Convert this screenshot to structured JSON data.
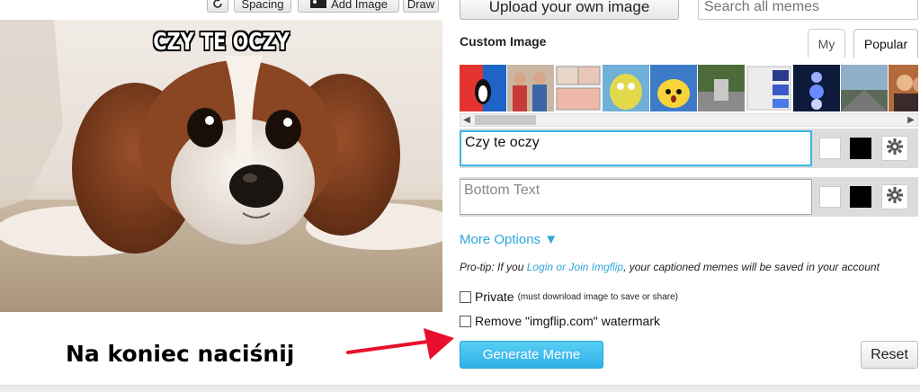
{
  "toolbar": {
    "rotate_icon": "rotate-icon",
    "spacing_label": "Spacing",
    "add_image_icon": "image-icon",
    "add_image_label": "Add Image",
    "draw_label": "Draw"
  },
  "meme": {
    "top_caption": "CZY TE OCZY"
  },
  "upload": {
    "label": "Upload your own image"
  },
  "search": {
    "placeholder": "Search all memes"
  },
  "custom_image": {
    "title": "Custom Image",
    "tabs": [
      "My",
      "Popular"
    ],
    "active_tab": "Popular"
  },
  "text_boxes": [
    {
      "value": "Czy te oczy",
      "placeholder": ""
    },
    {
      "value": "",
      "placeholder": "Bottom Text"
    }
  ],
  "colors": {
    "outline_white": "#ffffff",
    "outline_black": "#000000",
    "accent": "#2fa7dc",
    "generate": "#3bbdee"
  },
  "more_options": {
    "label": "More Options ▼"
  },
  "protip": {
    "prefix": "Pro-tip: If you ",
    "link": "Login or Join Imgflip",
    "suffix": ", your captioned memes will be saved in your account"
  },
  "private": {
    "label": "Private",
    "note": "(must download image to save or share)"
  },
  "watermark": {
    "label": "Remove \"imgflip.com\" watermark"
  },
  "generate": {
    "label": "Generate Meme"
  },
  "reset": {
    "label": "Reset"
  },
  "annotation": {
    "text": "Na koniec naciśnij"
  }
}
